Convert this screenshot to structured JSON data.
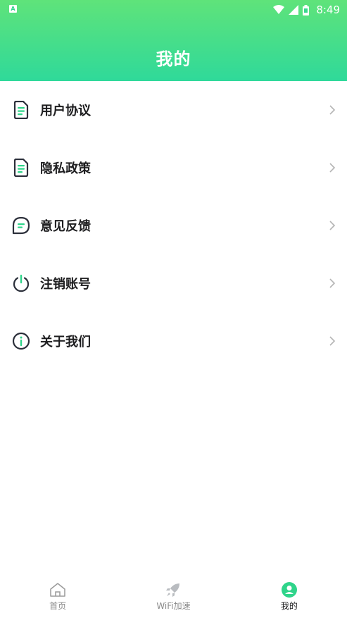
{
  "status_bar": {
    "app_badge": "A",
    "time": "8:49"
  },
  "header": {
    "title": "我的"
  },
  "menu": {
    "items": [
      {
        "label": "用户协议",
        "icon": "document-icon"
      },
      {
        "label": "隐私政策",
        "icon": "document-icon"
      },
      {
        "label": "意见反馈",
        "icon": "chat-bubble-icon"
      },
      {
        "label": "注销账号",
        "icon": "power-icon"
      },
      {
        "label": "关于我们",
        "icon": "info-icon"
      }
    ]
  },
  "tabbar": {
    "tabs": [
      {
        "label": "首页",
        "icon": "home-icon",
        "active": false
      },
      {
        "label": "WiFi加速",
        "icon": "rocket-icon",
        "active": false
      },
      {
        "label": "我的",
        "icon": "profile-icon",
        "active": true
      }
    ]
  },
  "colors": {
    "header_top": "#5fe37a",
    "header_bottom": "#2fd99a",
    "accent": "#2fd48a",
    "icon_dark": "#2b2f3a"
  }
}
